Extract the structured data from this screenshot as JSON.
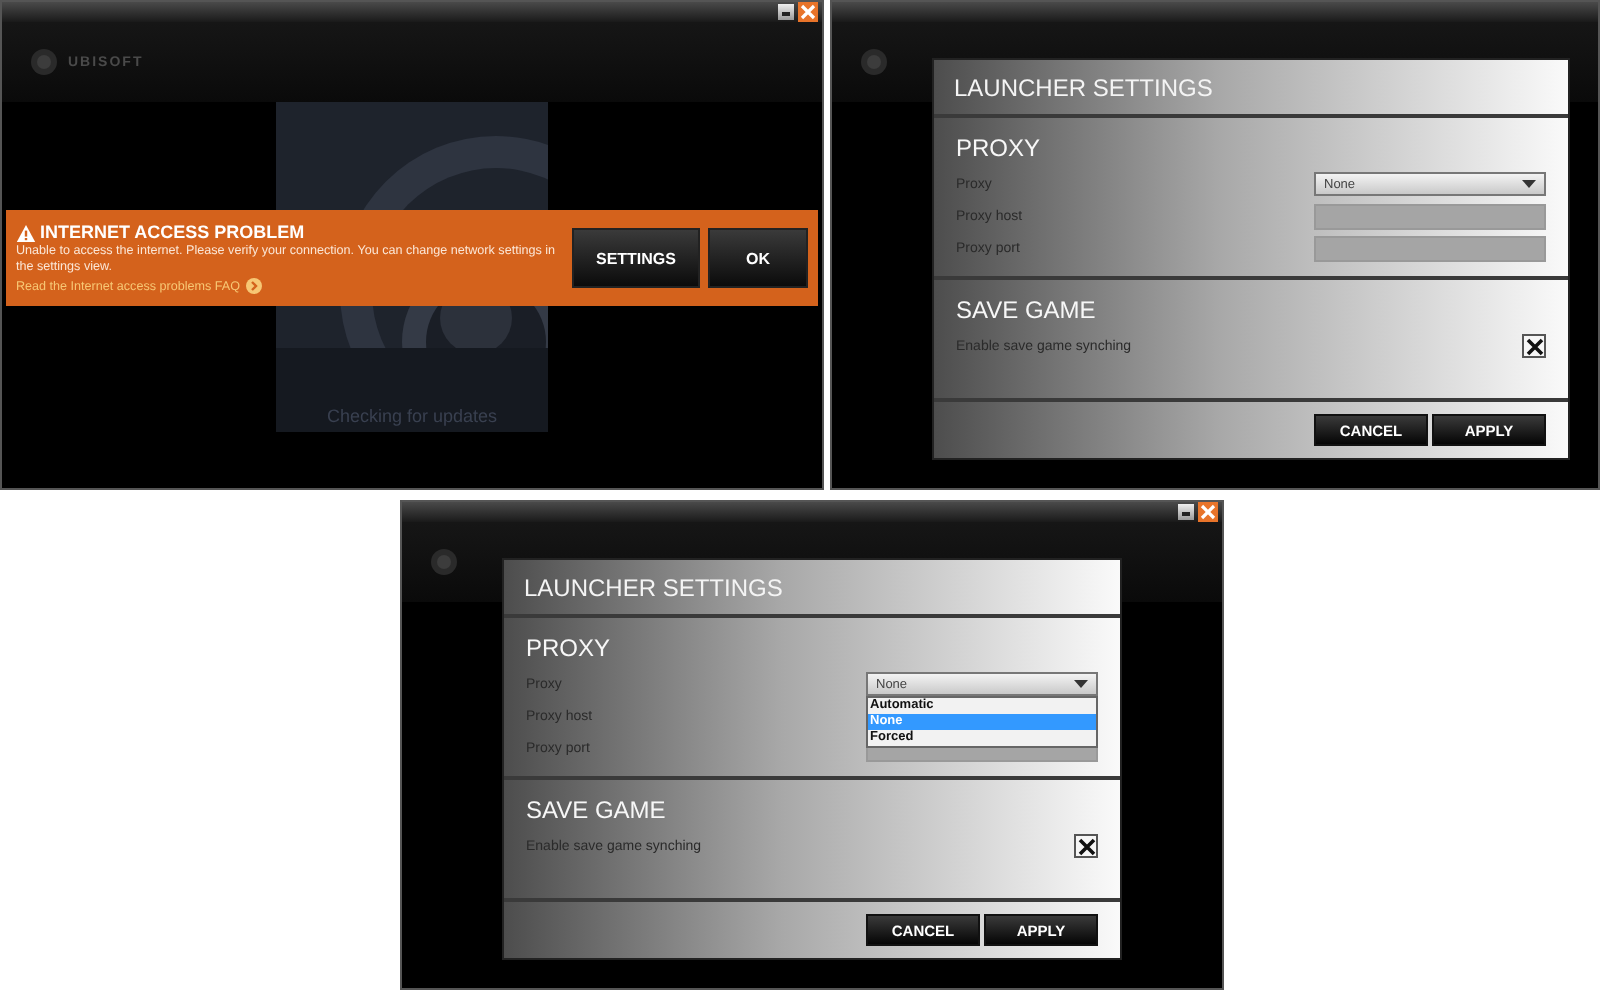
{
  "shots": [
    {
      "kind": "alert",
      "window_controls": true,
      "logo": "UBISOFT",
      "status": "Checking for updates",
      "alert": {
        "title": "INTERNET ACCESS PROBLEM",
        "message": "Unable to access the internet. Please verify your connection. You can change network settings in the settings view.",
        "link": "Read the Internet access problems FAQ",
        "buttons": [
          "SETTINGS",
          "OK"
        ]
      }
    },
    {
      "kind": "settings",
      "window_controls": false,
      "dialog": {
        "title": "LAUNCHER SETTINGS",
        "sections": [
          {
            "heading": "PROXY",
            "rows": [
              {
                "kind": "select",
                "label": "Proxy",
                "value": "None"
              },
              {
                "kind": "text",
                "label": "Proxy host"
              },
              {
                "kind": "text",
                "label": "Proxy port"
              }
            ]
          },
          {
            "heading": "SAVE GAME",
            "rows": [
              {
                "kind": "checkbox",
                "label": "Enable save game synching",
                "checked": true
              }
            ]
          }
        ],
        "buttons": [
          "CANCEL",
          "APPLY"
        ]
      }
    },
    {
      "kind": "settings",
      "window_controls": true,
      "dialog": {
        "title": "LAUNCHER SETTINGS",
        "sections": [
          {
            "heading": "PROXY",
            "rows": [
              {
                "kind": "select",
                "label": "Proxy",
                "value": "None",
                "options": [
                  {
                    "label": "Automatic",
                    "selected": false
                  },
                  {
                    "label": "None",
                    "selected": true
                  },
                  {
                    "label": "Forced",
                    "selected": false
                  }
                ]
              },
              {
                "kind": "text",
                "label": "Proxy host"
              },
              {
                "kind": "text",
                "label": "Proxy port"
              }
            ]
          },
          {
            "heading": "SAVE GAME",
            "rows": [
              {
                "kind": "checkbox",
                "label": "Enable save game synching",
                "checked": true
              }
            ]
          }
        ],
        "buttons": [
          "CANCEL",
          "APPLY"
        ]
      }
    }
  ]
}
